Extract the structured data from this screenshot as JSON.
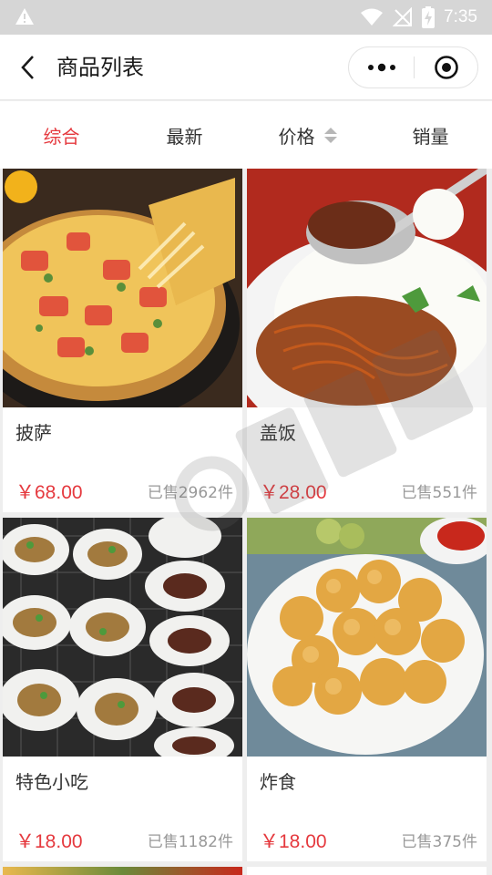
{
  "status_bar": {
    "time": "7:35"
  },
  "nav": {
    "title": "商品列表"
  },
  "tabs": [
    {
      "label": "综合",
      "active": true
    },
    {
      "label": "最新",
      "active": false
    },
    {
      "label": "价格",
      "active": false
    },
    {
      "label": "销量",
      "active": false
    }
  ],
  "products": [
    {
      "name": "披萨",
      "price": "￥68.00",
      "sold": "已售2962件",
      "image": "pizza"
    },
    {
      "name": "盖饭",
      "price": "￥28.00",
      "sold": "已售551件",
      "image": "rice-bowl"
    },
    {
      "name": "特色小吃",
      "price": "￥18.00",
      "sold": "已售1182件",
      "image": "snacks"
    },
    {
      "name": "炸食",
      "price": "￥18.00",
      "sold": "已售375件",
      "image": "fried-food"
    }
  ],
  "colors": {
    "accent": "#e5393e",
    "background": "#eeeeee"
  }
}
